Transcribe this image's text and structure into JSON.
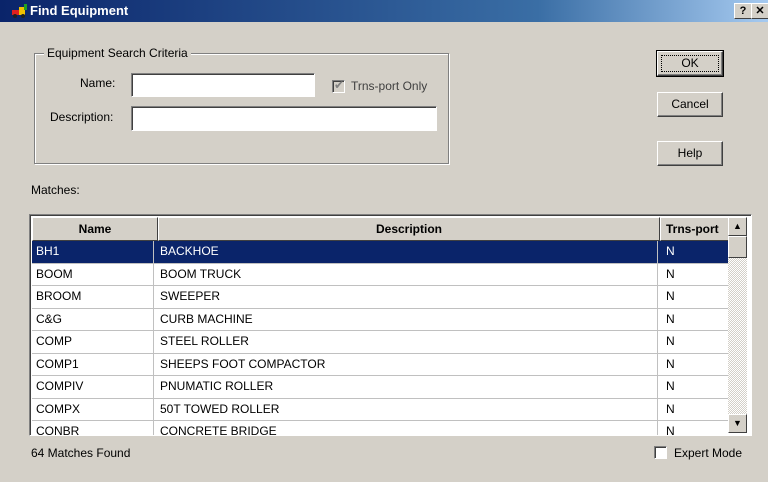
{
  "window": {
    "title": "Find Equipment",
    "help_glyph": "?",
    "close_glyph": "✕",
    "icon": "equipment-app-icon"
  },
  "criteria": {
    "group_label": "Equipment Search Criteria",
    "name_label": "Name:",
    "name_value": "",
    "description_label": "Description:",
    "description_value": "",
    "transport_only_label": "Trns-port Only",
    "transport_only_checked": true
  },
  "buttons": {
    "ok": "OK",
    "cancel": "Cancel",
    "help": "Help"
  },
  "matches_label": "Matches:",
  "table": {
    "columns": [
      "Name",
      "Description",
      "Trns-port"
    ],
    "rows": [
      {
        "name": "BH1",
        "description": "BACKHOE",
        "transport": "N",
        "selected": true
      },
      {
        "name": "BOOM",
        "description": "BOOM TRUCK",
        "transport": "N"
      },
      {
        "name": "BROOM",
        "description": "SWEEPER",
        "transport": "N"
      },
      {
        "name": "C&G",
        "description": "CURB MACHINE",
        "transport": "N"
      },
      {
        "name": "COMP",
        "description": "STEEL ROLLER",
        "transport": "N"
      },
      {
        "name": "COMP1",
        "description": "SHEEPS FOOT COMPACTOR",
        "transport": "N"
      },
      {
        "name": "COMPIV",
        "description": "PNUMATIC ROLLER",
        "transport": "N"
      },
      {
        "name": "COMPX",
        "description": "50T TOWED ROLLER",
        "transport": "N"
      },
      {
        "name": "CONBR",
        "description": "CONCRETE BRIDGE",
        "transport": "N"
      }
    ],
    "scroll_up_glyph": "▲",
    "scroll_down_glyph": "▼"
  },
  "status": {
    "matches_found": "64 Matches Found",
    "expert_mode_label": "Expert Mode",
    "expert_mode_checked": false
  },
  "colors": {
    "title_bar": "#0a246a",
    "selection": "#0a246a",
    "dialog_face": "#d4d0c8"
  }
}
